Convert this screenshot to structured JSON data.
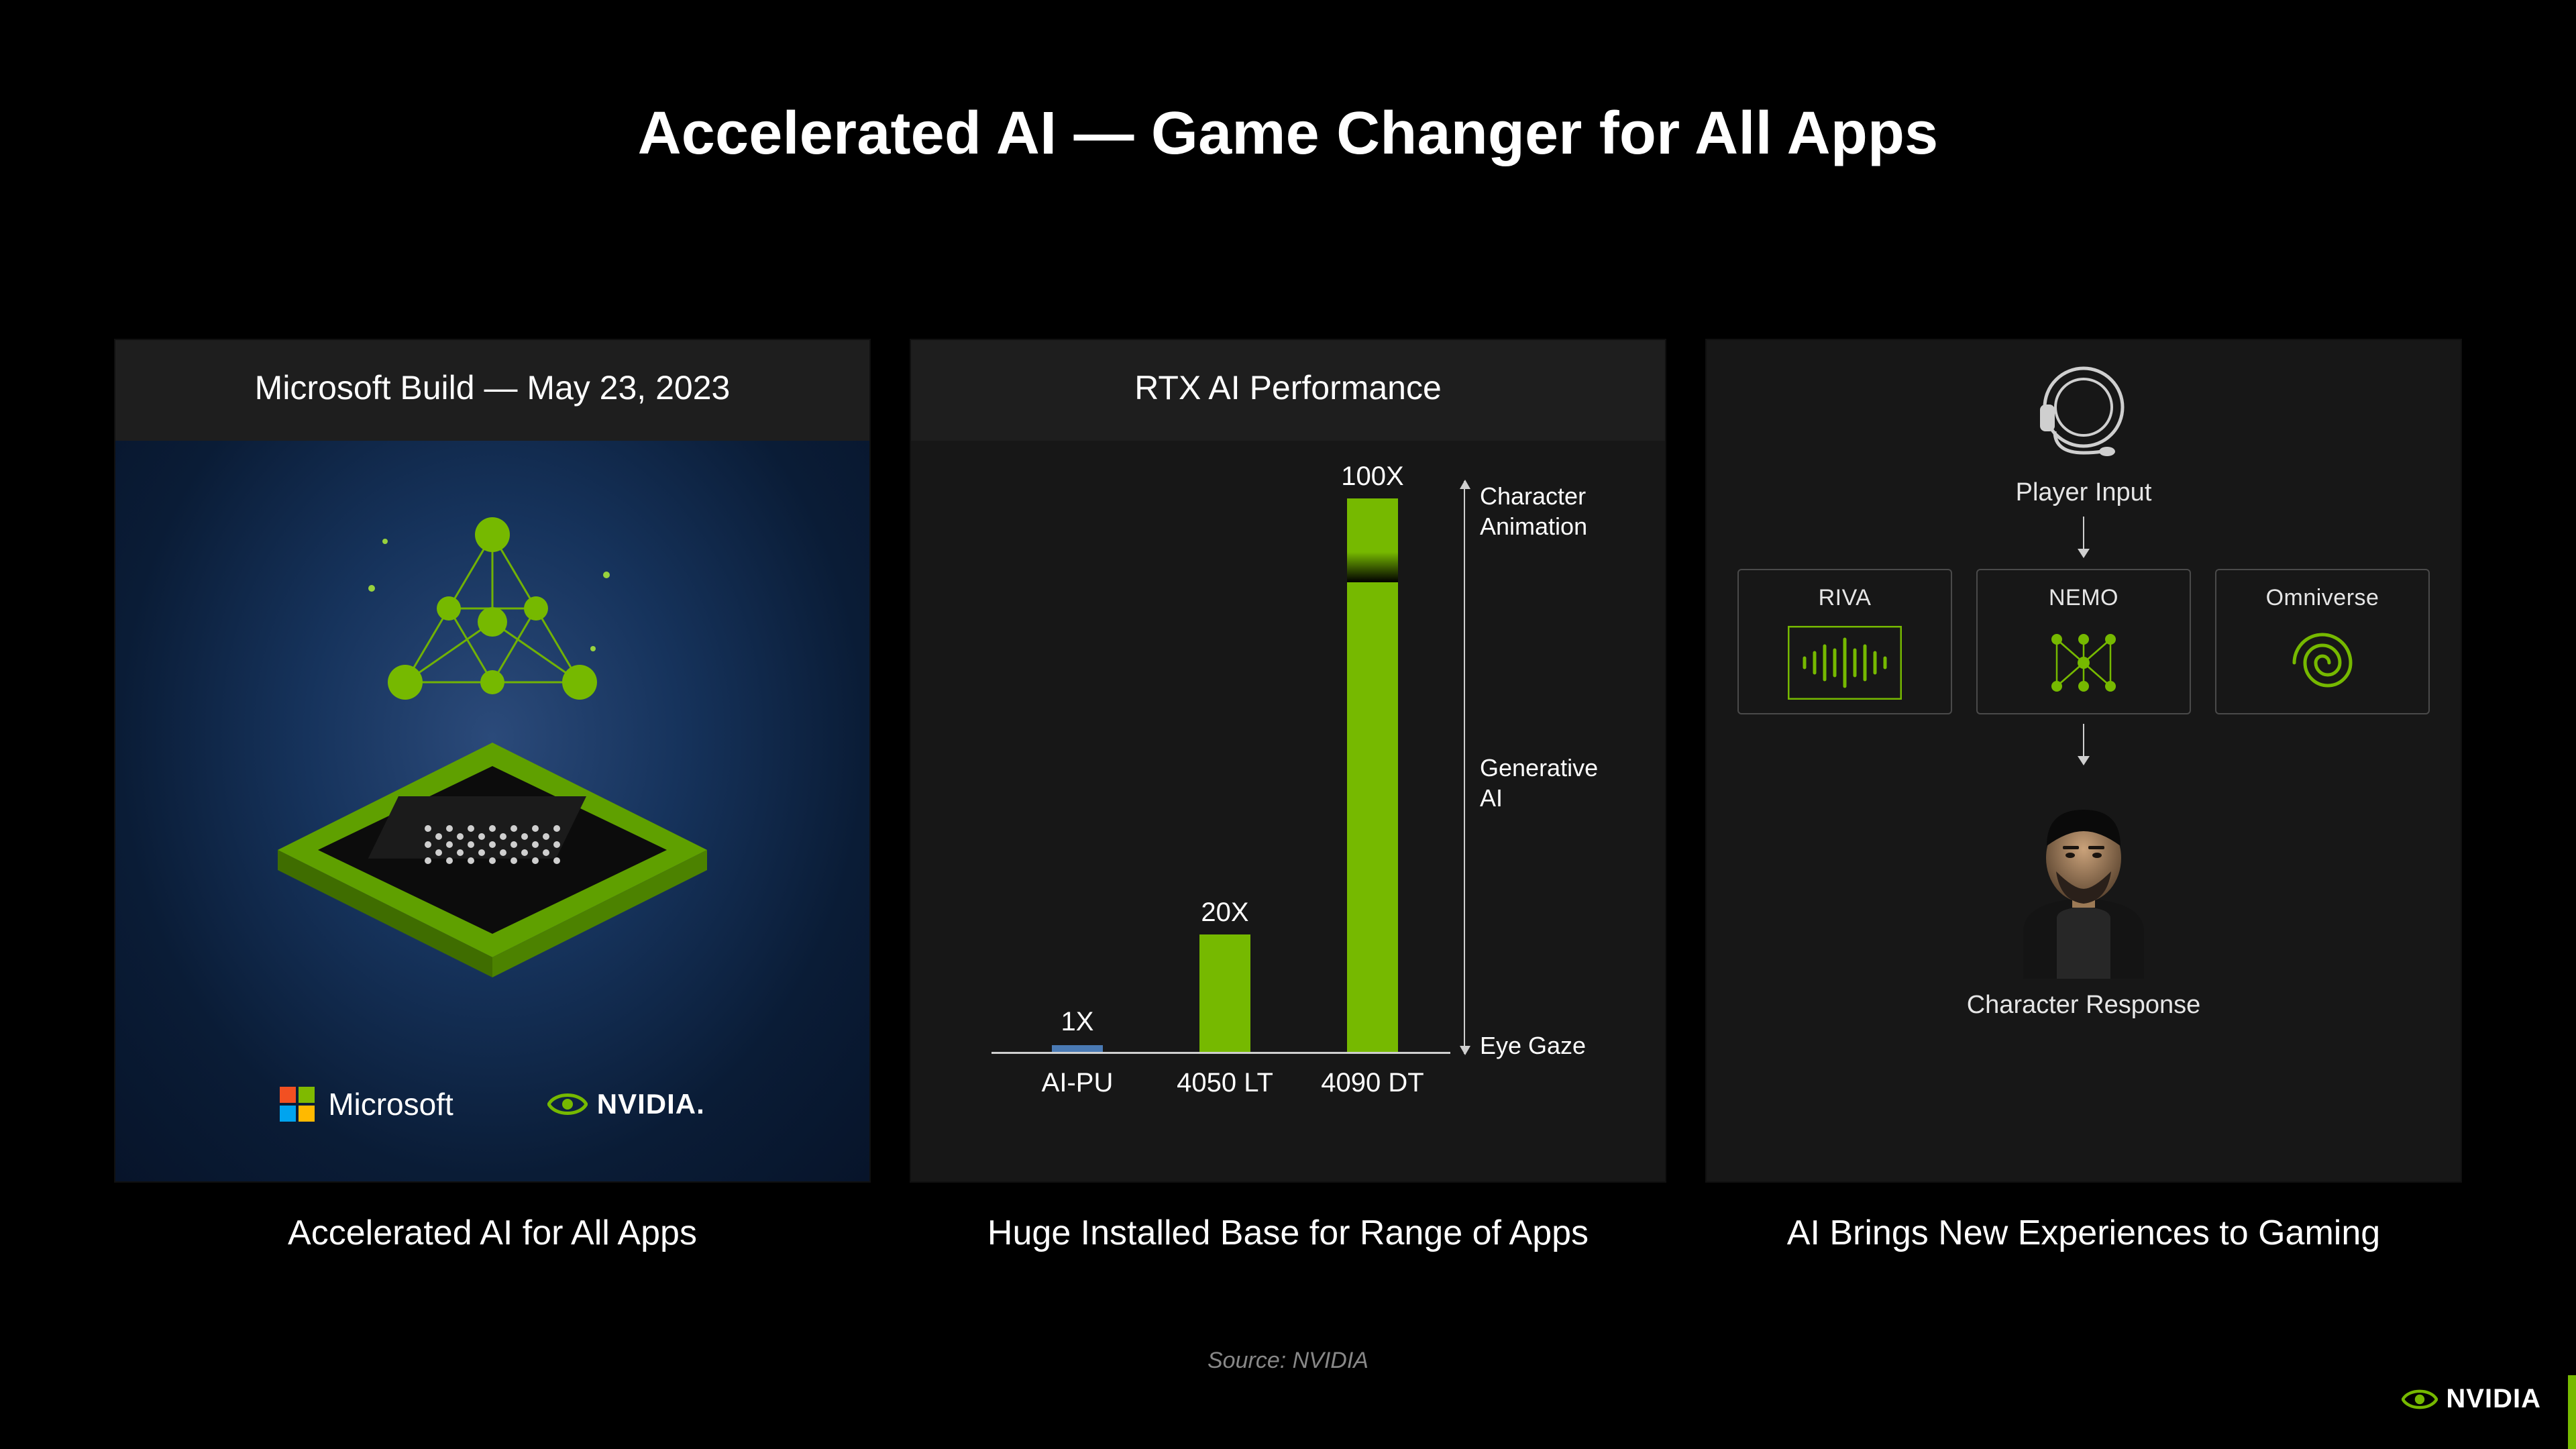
{
  "title": "Accelerated AI — Game Changer for All Apps",
  "panels": {
    "0": {
      "header": "Microsoft Build — May 23, 2023",
      "logo_ms": "Microsoft",
      "logo_nv": "NVIDIA.",
      "caption": "Accelerated AI for All Apps"
    },
    "1": {
      "header": "RTX AI Performance",
      "caption": "Huge Installed Base for Range of Apps"
    },
    "2": {
      "header_top": "Player Input",
      "box0": "RIVA",
      "box1": "NEMO",
      "box2": "Omniverse",
      "bottom": "Character Response",
      "caption": "AI Brings New Experiences to Gaming"
    }
  },
  "source": "Source: NVIDIA",
  "footer_brand": "NVIDIA",
  "chart_data": {
    "type": "bar",
    "title": "RTX AI Performance",
    "categories": [
      "AI-PU",
      "4050 LT",
      "4090 DT"
    ],
    "value_labels": [
      "1X",
      "20X",
      "100X"
    ],
    "values": [
      1,
      20,
      100
    ],
    "ylim": [
      0,
      100
    ],
    "xlabel": "",
    "ylabel": "",
    "right_axis_annotations": {
      "top": "Character Animation",
      "middle": "Generative AI",
      "bottom": "Eye Gaze"
    },
    "colors": {
      "default": "#76b900",
      "first": "#4a7ab4"
    }
  }
}
